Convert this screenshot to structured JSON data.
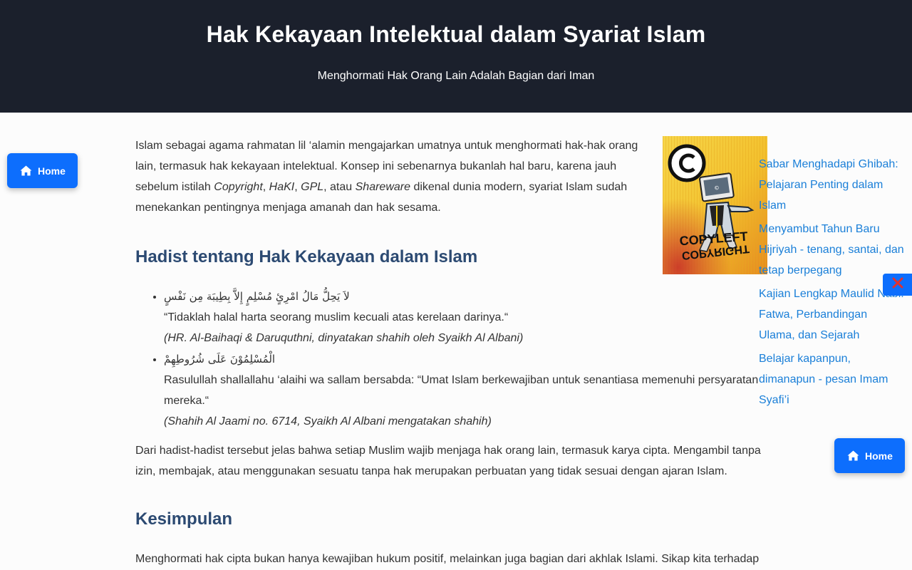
{
  "header": {
    "title": "Hak Kekayaan Intelektual dalam Syariat Islam",
    "subtitle": "Menghormati Hak Orang Lain Adalah Bagian dari Iman"
  },
  "nav": {
    "home_label": "Home",
    "home_label_right": "Home"
  },
  "article": {
    "intro": {
      "t1": "Islam sebagai agama rahmatan lil ‘alamin mengajarkan umatnya untuk menghormati hak-hak orang lain, termasuk hak kekayaan intelektual. Konsep ini sebenarnya bukanlah hal baru, karena jauh sebelum istilah ",
      "copyright": "Copyright",
      "sep1": ", ",
      "haki": "HaKI",
      "sep2": ", ",
      "gpl": "GPL",
      "sep3": ", atau ",
      "shareware": "Shareware",
      "t2": " dikenal dunia modern, syariat Islam sudah menekankan pentingnya menjaga amanah dan hak sesama."
    },
    "heading_hadist": "Hadist tentang Hak Kekayaan dalam Islam",
    "hadist": [
      {
        "arabic": "لاَ يَحِلُّ مَالُ امْرِئٍ مُسْلِمٍ إِلاَّ بِطِيبَة مِن نَفْسٍ",
        "translation": "“Tidaklah halal harta seorang muslim kecuali atas kerelaan darinya.“",
        "source": "(HR. Al-Baihaqi & Daruquthni, dinyatakan shahih oleh Syaikh Al Albani)"
      },
      {
        "arabic": "الْمُسْلِمُوْنَ عَلَى شُرُوطِهِمْ",
        "translation": "Rasulullah shallallahu ‘alaihi wa sallam bersabda: “Umat Islam berkewajiban untuk senantiasa memenuhi persyaratan mereka.“",
        "source": "(Shahih Al Jaami no. 6714, Syaikh Al Albani mengatakan shahih)"
      }
    ],
    "para2": "Dari hadist-hadist tersebut jelas bahwa setiap Muslim wajib menjaga hak orang lain, termasuk karya cipta. Mengambil tanpa izin, membajak, atau menggunakan sesuatu tanpa hak merupakan perbuatan yang tidak sesuai dengan ajaran Islam.",
    "heading_kesimpulan": "Kesimpulan",
    "para3": "Menghormati hak cipta bukan hanya kewajiban hukum positif, melainkan juga bagian dari akhlak Islami. Sikap kita terhadap"
  },
  "image": {
    "logo_text_1": "COPYLEFT",
    "logo_text_2": "COPYRIGHT",
    "icon": "copyright-symbol"
  },
  "related": [
    {
      "label": "Sabar Menghadapi Ghibah: Pelajaran Penting dalam Islam"
    },
    {
      "label": "Menyambut Tahun Baru Hijriyah - tenang, santai, dan tetap berpegang"
    },
    {
      "label": "Kajian Lengkap Maulid Nabi: Fatwa, Perbandingan Ulama, dan Sejarah"
    },
    {
      "label": "Belajar kapanpun, dimanapun - pesan Imam Syafi’i"
    }
  ],
  "colors": {
    "header_bg": "#1b202c",
    "accent": "#0d6efd",
    "heading": "#2c4a72",
    "link": "#1a7fd8",
    "close_icon": "#e03131"
  }
}
